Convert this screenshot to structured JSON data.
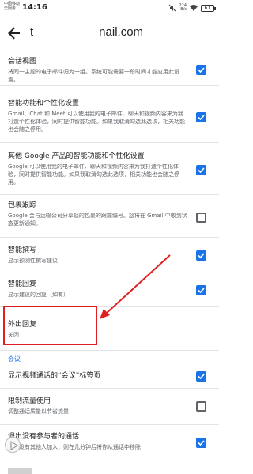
{
  "status_bar": {
    "carrier_line1": "中国移动",
    "carrier_line2": "无服务",
    "time": "14:16",
    "speed_value": "224",
    "speed_unit": "B/s",
    "battery": "61"
  },
  "app_bar": {
    "title_start": "t",
    "title_end": "nail.com"
  },
  "settings": [
    {
      "title": "会话视图",
      "subtitle": "将同一主题的电子邮件归为一组。系统可能需要一段时间才能应用此设置。",
      "checked": true
    },
    {
      "title": "智能功能和个性化设置",
      "subtitle": "Gmail、Chat 和 Meet 可以使用我的电子邮件、聊天和视频内容来为我打造个性化体验，同时提供智能功能。如果我取消勾选此选项，相关功能也会随之停用。",
      "checked": true
    },
    {
      "title": "其他 Google 产品的智能功能和个性化设置",
      "subtitle": "Google 可以使用我的电子邮件、聊天和视频内容来为我打造个性化体验，同时提供智能功能。如果我取消勾选此选项，相关功能也会随之停用。",
      "checked": true
    },
    {
      "title": "包裹跟踪",
      "subtitle": "Google 会与运输公司分享您的包裹的跟踪编号。您将在 Gmail 中收到状态更新通知。",
      "checked": false
    },
    {
      "title": "智能撰写",
      "subtitle": "显示预测性撰写建议",
      "checked": true
    },
    {
      "title": "智能回复",
      "subtitle": "显示建议的回复（如有）",
      "checked": true
    },
    {
      "title": "外出回复",
      "subtitle": "关闭"
    }
  ],
  "meeting_section": {
    "label": "会议",
    "items": [
      {
        "title": "显示视频通话的“会议”标签页",
        "checked": true
      },
      {
        "title": "限制流量使用",
        "subtitle": "调整通话质量以节省流量",
        "checked": false
      },
      {
        "title": "退出没有参与者的通话",
        "subtitle": "如果没有其他人加入，则在几分钟后将你从通话中移除",
        "checked": true
      }
    ]
  },
  "colors": {
    "accent": "#1a73e8",
    "annotation": "#e02020"
  }
}
